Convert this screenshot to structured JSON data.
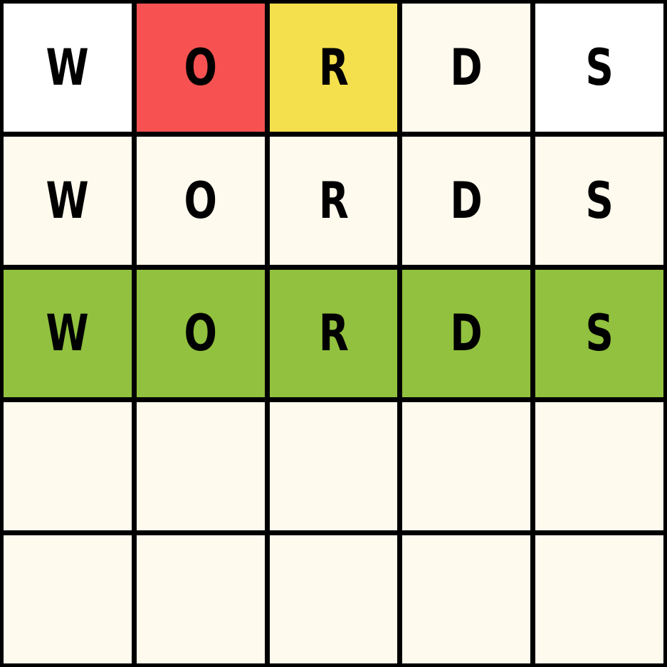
{
  "board": {
    "rows": [
      [
        {
          "letter": "W",
          "state": "white"
        },
        {
          "letter": "O",
          "state": "red"
        },
        {
          "letter": "R",
          "state": "yellow"
        },
        {
          "letter": "D",
          "state": "cream"
        },
        {
          "letter": "S",
          "state": "white"
        }
      ],
      [
        {
          "letter": "W",
          "state": "cream"
        },
        {
          "letter": "O",
          "state": "cream"
        },
        {
          "letter": "R",
          "state": "cream"
        },
        {
          "letter": "D",
          "state": "cream"
        },
        {
          "letter": "S",
          "state": "cream"
        }
      ],
      [
        {
          "letter": "W",
          "state": "green"
        },
        {
          "letter": "O",
          "state": "green"
        },
        {
          "letter": "R",
          "state": "green"
        },
        {
          "letter": "D",
          "state": "green"
        },
        {
          "letter": "S",
          "state": "green"
        }
      ],
      [
        {
          "letter": "",
          "state": "cream"
        },
        {
          "letter": "",
          "state": "cream"
        },
        {
          "letter": "",
          "state": "cream"
        },
        {
          "letter": "",
          "state": "cream"
        },
        {
          "letter": "",
          "state": "cream"
        }
      ],
      [
        {
          "letter": "",
          "state": "cream"
        },
        {
          "letter": "",
          "state": "cream"
        },
        {
          "letter": "",
          "state": "cream"
        },
        {
          "letter": "",
          "state": "cream"
        },
        {
          "letter": "",
          "state": "cream"
        }
      ]
    ]
  },
  "colors": {
    "white": "#ffffff",
    "cream": "#fffaee",
    "red": "#f75151",
    "yellow": "#f4e04c",
    "green": "#92c13f",
    "grid_line": "#000000",
    "letter": "#000000"
  }
}
